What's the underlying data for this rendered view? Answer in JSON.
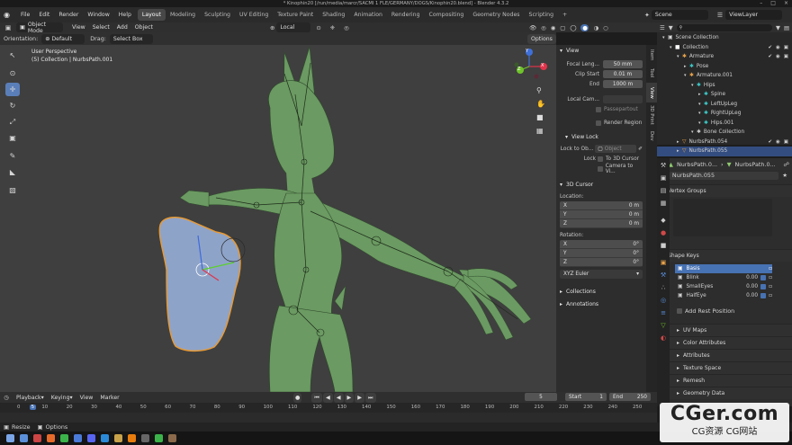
{
  "title_bar": {
    "text": "* Kinophin20 [/run/media/marcr/SACMI 1 FLE/GERMANY/DOGS/Kinophin20.blend] - Blender 4.3.2",
    "controls": [
      "–",
      "□",
      "×"
    ]
  },
  "top_menu": {
    "items": [
      "File",
      "Edit",
      "Render",
      "Window",
      "Help"
    ],
    "workspaces": [
      "Layout",
      "Modeling",
      "Sculpting",
      "UV Editing",
      "Texture Paint",
      "Shading",
      "Animation",
      "Rendering",
      "Compositing",
      "Geometry Nodes",
      "Scripting"
    ],
    "active_workspace": "Layout",
    "add_tab": "+",
    "scene_label": "Scene",
    "view_layer_label": "ViewLayer"
  },
  "viewport_header": {
    "mode": "Object Mode",
    "menus": [
      "View",
      "Select",
      "Add",
      "Object"
    ],
    "transform_orientation": "Local",
    "options_label": "Options"
  },
  "tool_settings": {
    "orientation_label": "Orientation:",
    "orientation_value": "Default",
    "drag_label": "Drag:",
    "drag_value": "Select Box"
  },
  "viewport": {
    "perspective_label": "User Perspective",
    "collection_label": "(5) Collection | NurbsPath.001",
    "gizmo_axes": [
      "Y",
      "X",
      "Z"
    ]
  },
  "toolbar_icons": [
    "cursor-select-icon",
    "cursor-3d-icon",
    "move-icon",
    "rotate-icon",
    "scale-icon",
    "transform-icon",
    "annotate-icon",
    "measure-icon",
    "add-cube-icon"
  ],
  "n_panel": {
    "view_header": "View",
    "focal_length_label": "Focal Leng...",
    "focal_length_value": "50 mm",
    "clip_start_label": "Clip Start",
    "clip_start_value": "0.01 m",
    "clip_end_label": "End",
    "clip_end_value": "1000 m",
    "local_camera_label": "Local Cam...",
    "passepartout_label": "Passepartout",
    "render_region_label": "Render Region",
    "view_lock_header": "View Lock",
    "lock_to_object_label": "Lock to Ob...",
    "lock_to_object_placeholder": "Object",
    "lock_label": "Lock",
    "to_3d_cursor_label": "To 3D Cursor",
    "camera_to_view_label": "Camera to Vi...",
    "cursor_header": "3D Cursor",
    "location_label": "Location:",
    "location": [
      {
        "axis": "X",
        "value": "0 m"
      },
      {
        "axis": "Y",
        "value": "0 m"
      },
      {
        "axis": "Z",
        "value": "0 m"
      }
    ],
    "rotation_label": "Rotation:",
    "rotation": [
      {
        "axis": "X",
        "value": "0°"
      },
      {
        "axis": "Y",
        "value": "0°"
      },
      {
        "axis": "Z",
        "value": "0°"
      }
    ],
    "rotation_mode": "XYZ Euler",
    "collections_header": "Collections",
    "annotations_header": "Annotations",
    "side_tabs": [
      "Item",
      "Tool",
      "View",
      "3D Print",
      "Dev"
    ],
    "active_side_tab": "View"
  },
  "outliner": {
    "search_placeholder": "",
    "rows": [
      {
        "label": "Scene Collection",
        "indent": 0
      },
      {
        "label": "Collection",
        "indent": 1
      },
      {
        "label": "Armature",
        "indent": 2
      },
      {
        "label": "Pose",
        "indent": 3
      },
      {
        "label": "Armature.001",
        "indent": 3
      },
      {
        "label": "Hips",
        "indent": 4
      },
      {
        "label": "Spine",
        "indent": 5
      },
      {
        "label": "LeftUpLeg",
        "indent": 5
      },
      {
        "label": "RightUpLeg",
        "indent": 5
      },
      {
        "label": "Hips.001",
        "indent": 5
      },
      {
        "label": "Bone Collection",
        "indent": 4
      },
      {
        "label": "NurbsPath.054",
        "indent": 2
      },
      {
        "label": "NurbsPath.055",
        "indent": 2
      }
    ]
  },
  "properties": {
    "breadcrumb_object": "NurbsPath.0...",
    "breadcrumb_data": "NurbsPath.0...",
    "data_name": "NurbsPath.055",
    "vertex_groups_header": "Vertex Groups",
    "shape_keys_header": "Shape Keys",
    "shape_keys": [
      {
        "name": "Basis",
        "value": ""
      },
      {
        "name": "Blink",
        "value": "0.00"
      },
      {
        "name": "SmallEyes",
        "value": "0.00"
      },
      {
        "name": "HalfEye",
        "value": "0.00"
      }
    ],
    "add_rest_position_label": "Add Rest Position",
    "panels": [
      "UV Maps",
      "Color Attributes",
      "Attributes",
      "Texture Space",
      "Remesh",
      "Geometry Data"
    ]
  },
  "timeline": {
    "menus": [
      "Playback",
      "Keying",
      "View",
      "Marker"
    ],
    "current_frame": "5",
    "start_label": "Start",
    "start_value": "1",
    "end_label": "End",
    "end_value": "250",
    "ruler_ticks": [
      "0",
      "5",
      "10",
      "20",
      "30",
      "40",
      "50",
      "60",
      "70",
      "80",
      "90",
      "100",
      "110",
      "120",
      "130",
      "140",
      "150",
      "160",
      "170",
      "180",
      "190",
      "200",
      "210",
      "220",
      "230",
      "240",
      "250"
    ],
    "current_tick": "5"
  },
  "status_bar": {
    "items": [
      "Resize",
      "Options"
    ]
  },
  "watermark": {
    "line1": "CGer.com",
    "line2": "CG资源 CG网站"
  },
  "colors": {
    "accent": "#4772b3",
    "viewport_bg": "#3f3f3f",
    "body_green": "#6b9a62",
    "selected_mesh": "#8ea3c8",
    "selection_outline": "#e89a33"
  }
}
